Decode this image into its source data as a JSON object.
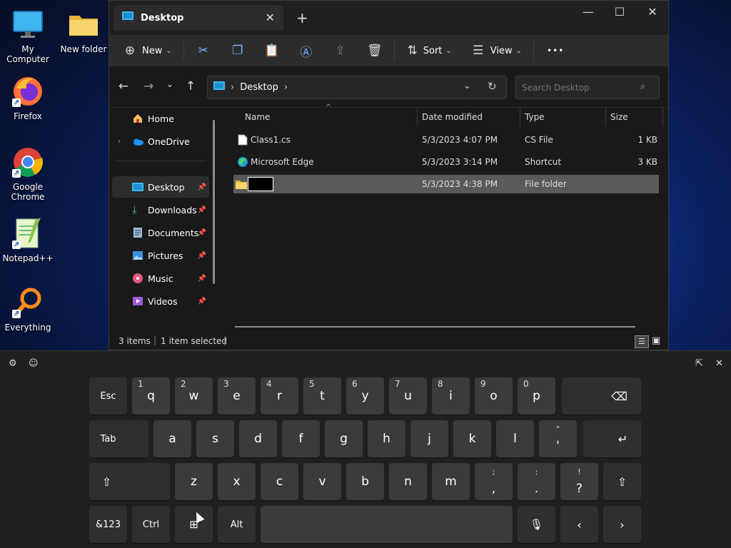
{
  "desktop": {
    "icons": [
      {
        "label": "My Computer",
        "icon": "monitor-icon"
      },
      {
        "label": "New folder",
        "icon": "folder-icon"
      },
      {
        "label": "Firefox",
        "icon": "firefox-icon"
      },
      {
        "label": "Google Chrome",
        "icon": "chrome-icon"
      },
      {
        "label": "Notepad++",
        "icon": "notepadpp-icon"
      },
      {
        "label": "Everything",
        "icon": "everything-search-icon"
      }
    ]
  },
  "explorer": {
    "tab_title": "Desktop",
    "toolbar": {
      "new_label": "New",
      "sort_label": "Sort",
      "view_label": "View",
      "more_label": "•••"
    },
    "address": {
      "crumb": "Desktop",
      "sep": "›"
    },
    "search": {
      "placeholder": "Search Desktop"
    },
    "sidebar": {
      "items": [
        {
          "label": "Home"
        },
        {
          "label": "OneDrive"
        },
        {
          "label": "Desktop"
        },
        {
          "label": "Downloads"
        },
        {
          "label": "Documents"
        },
        {
          "label": "Pictures"
        },
        {
          "label": "Music"
        },
        {
          "label": "Videos"
        }
      ]
    },
    "columns": {
      "name": "Name",
      "date": "Date modified",
      "type": "Type",
      "size": "Size"
    },
    "files": [
      {
        "name": "Class1.cs",
        "date": "5/3/2023 4:07 PM",
        "type": "CS File",
        "size": "1 KB"
      },
      {
        "name": "Microsoft Edge",
        "date": "5/3/2023 3:14 PM",
        "type": "Shortcut",
        "size": "3 KB"
      },
      {
        "name": "",
        "date": "5/3/2023 4:38 PM",
        "type": "File folder",
        "size": ""
      }
    ],
    "status": {
      "items": "3 items",
      "selected": "1 item selected"
    }
  },
  "keyboard": {
    "row1": [
      {
        "label": "Esc"
      },
      {
        "label": "q",
        "sub": "1"
      },
      {
        "label": "w",
        "sub": "2"
      },
      {
        "label": "e",
        "sub": "3"
      },
      {
        "label": "r",
        "sub": "4"
      },
      {
        "label": "t",
        "sub": "5"
      },
      {
        "label": "y",
        "sub": "6"
      },
      {
        "label": "u",
        "sub": "7"
      },
      {
        "label": "i",
        "sub": "8"
      },
      {
        "label": "o",
        "sub": "9"
      },
      {
        "label": "p",
        "sub": "0"
      }
    ],
    "row2": [
      {
        "label": "Tab"
      },
      {
        "label": "a"
      },
      {
        "label": "s"
      },
      {
        "label": "d"
      },
      {
        "label": "f"
      },
      {
        "label": "g"
      },
      {
        "label": "h"
      },
      {
        "label": "j"
      },
      {
        "label": "k"
      },
      {
        "label": "l"
      },
      {
        "label": "'",
        "top": "\""
      }
    ],
    "row3": [
      {
        "label": "z"
      },
      {
        "label": "x"
      },
      {
        "label": "c"
      },
      {
        "label": "v"
      },
      {
        "label": "b"
      },
      {
        "label": "n"
      },
      {
        "label": "m"
      },
      {
        "label": ",",
        "top": ";"
      },
      {
        "label": ".",
        "top": ":"
      },
      {
        "label": "?",
        "top": "!"
      }
    ],
    "row4": {
      "sym": "&123",
      "ctrl": "Ctrl",
      "alt": "Alt"
    }
  }
}
